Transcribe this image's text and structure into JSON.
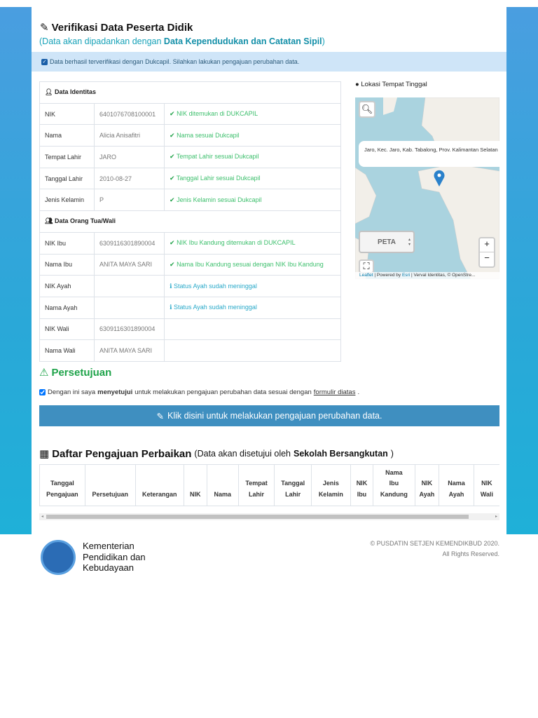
{
  "header": {
    "title": "Verifikasi Data Peserta Didik",
    "subtitle_prefix": "(Data akan dipadankan dengan ",
    "subtitle_bold": "Data Kependudukan dan Catatan Sipil",
    "subtitle_suffix": ")"
  },
  "alert": "Data berhasil terverifikasi dengan Dukcapil. Silahkan lakukan pengajuan perubahan data.",
  "identitas": {
    "section": "Data Identitas",
    "rows": [
      {
        "label": "NIK",
        "value": "6401076708100001",
        "status": "NIK ditemukan di DUKCAPIL",
        "type": "ok"
      },
      {
        "label": "Nama",
        "value": "Alicia Anisafitri",
        "status": "Nama sesuai Dukcapil",
        "type": "ok"
      },
      {
        "label": "Tempat Lahir",
        "value": "JARO",
        "status": "Tempat Lahir sesuai Dukcapil",
        "type": "ok"
      },
      {
        "label": "Tanggal Lahir",
        "value": "2010-08-27",
        "status": "Tanggal Lahir sesuai Dukcapil",
        "type": "ok"
      },
      {
        "label": "Jenis Kelamin",
        "value": "P",
        "status": "Jenis Kelamin sesuai Dukcapil",
        "type": "ok"
      }
    ]
  },
  "ortu": {
    "section": "Data Orang Tua/Wali",
    "rows": [
      {
        "label": "NIK Ibu",
        "value": "6309116301890004",
        "status": "NIK Ibu Kandung ditemukan di DUKCAPIL",
        "type": "ok"
      },
      {
        "label": "Nama Ibu",
        "value": "ANITA MAYA SARI",
        "status": "Nama Ibu Kandung sesuai dengan NIK Ibu Kandung",
        "type": "ok"
      },
      {
        "label": "NIK Ayah",
        "value": "",
        "status": "Status Ayah sudah meninggal",
        "type": "info"
      },
      {
        "label": "Nama Ayah",
        "value": "",
        "status": "Status Ayah sudah meninggal",
        "type": "info"
      },
      {
        "label": "NIK Wali",
        "value": "6309116301890004",
        "status": "",
        "type": ""
      },
      {
        "label": "Nama Wali",
        "value": "ANITA MAYA SARI",
        "status": "",
        "type": ""
      }
    ]
  },
  "map": {
    "label": "Lokasi Tempat Tinggal",
    "popup": "Jaro, Kec. Jaro, Kab. Tabalong, Prov. Kalimantan Selatan",
    "layer": "PETA",
    "zoom_in": "+",
    "zoom_out": "−",
    "attr_leaflet": "Leaflet",
    "attr_mid": " | Powered by ",
    "attr_esri": "Esri",
    "attr_end": " | Verval Identitas, © OpenStre..."
  },
  "persetujuan": {
    "title": "Persetujuan",
    "text1": "Dengan ini saya ",
    "bold": "menyetujui",
    "text2": " untuk melakukan pengajuan perubahan data sesuai dengan ",
    "link": "formulir diatas",
    "end": ".",
    "checked": true,
    "button": "Klik disini untuk melakukan pengajuan perubahan data."
  },
  "daftar": {
    "title": "Daftar Pengajuan Perbaikan",
    "note1": " (Data akan disetujui oleh ",
    "note_bold": "Sekolah Bersangkutan",
    "note2": ")",
    "columns": [
      "Tanggal Pengajuan",
      "Persetujuan",
      "Keterangan",
      "NIK",
      "Nama",
      "Tempat Lahir",
      "Tanggal Lahir",
      "Jenis Kelamin",
      "NIK Ibu",
      "Nama Ibu Kandung",
      "NIK Ayah",
      "Nama Ayah",
      "NIK Wali"
    ]
  },
  "footer": {
    "org": "Kementerian Pendidikan dan Kebudayaan",
    "org_lines": [
      "Kementerian",
      "Pendidikan dan",
      "Kebudayaan"
    ],
    "copyright": "© PUSDATIN SETJEN KEMENDIKBUD 2020.",
    "rights": "All Rights Reserved."
  }
}
